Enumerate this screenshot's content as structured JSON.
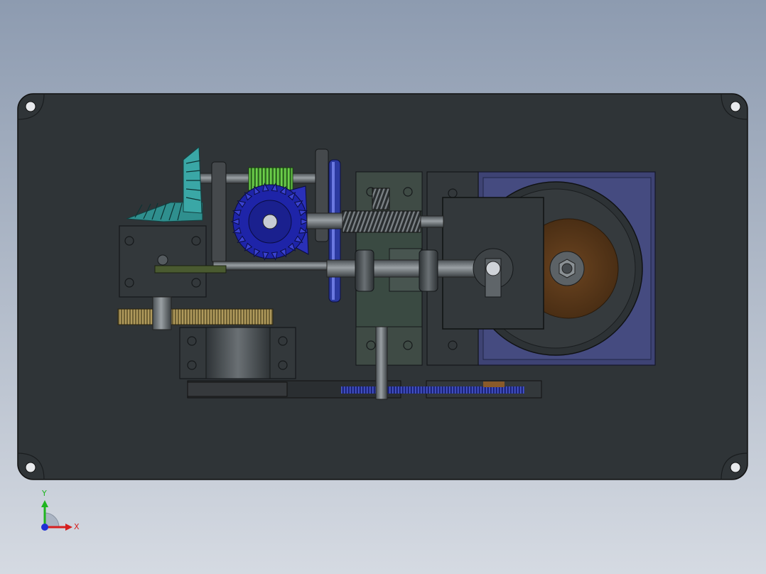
{
  "colors": {
    "background_top": "#8d9bb0",
    "background_bottom": "#d5dae2",
    "base_plate": "#2f3437",
    "part_gray": "#3c4144",
    "shaft": "#6a7074",
    "bevel_gear_teal": "#3aa7a6",
    "worm_green": "#52a83a",
    "bevel_gear_blue": "#1e24a8",
    "pulley_blue": "#2c3aa0",
    "spur_gear_olive": "#8c7a48",
    "grinding_disc_brown": "#5a3a1c",
    "motor_mount_purple": "#3e4374",
    "axis_x": "#d61f1f",
    "axis_y": "#1fb51f",
    "axis_z": "#1f2fd6"
  },
  "triad": {
    "x_label": "X",
    "y_label": "Y"
  }
}
